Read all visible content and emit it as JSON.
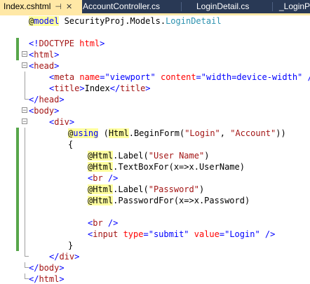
{
  "tabs": [
    {
      "label": "Index.cshtml",
      "active": true
    },
    {
      "label": "AccountController.cs",
      "active": false
    },
    {
      "label": "LoginDetail.cs",
      "active": false
    },
    {
      "label": "_LoginP",
      "active": false
    }
  ],
  "icons": {
    "pin": "pin-icon",
    "close": "close-icon",
    "collapse": "collapse-minus-icon"
  },
  "colors": {
    "tab_strip": "#293955",
    "active_tab": "#ffe8a6",
    "change_bar": "#57a64a",
    "razor_highlight": "#ffff9e"
  },
  "code": {
    "l1": {
      "at": "@",
      "kw": "model",
      "ns": " SecurityProj.Models.",
      "type": "LoginDetail"
    },
    "l3": {
      "open": "<!",
      "tag": "DOCTYPE",
      "attr": " html",
      "close": ">"
    },
    "l4": {
      "open": "<",
      "tag": "html",
      "close": ">"
    },
    "l5": {
      "open": "<",
      "tag": "head",
      "close": ">"
    },
    "l6": {
      "open": "<",
      "tag": "meta",
      "a1": " name",
      "eq1": "=",
      "v1": "\"viewport\"",
      "a2": " content",
      "eq2": "=",
      "v2": "\"width=device-width\"",
      "close": " />"
    },
    "l7": {
      "open": "<",
      "tag": "title",
      "mid": ">",
      "text": "Index",
      "open2": "</",
      "tag2": "title",
      "close": ">"
    },
    "l8": {
      "open": "</",
      "tag": "head",
      "close": ">"
    },
    "l9": {
      "open": "<",
      "tag": "body",
      "close": ">"
    },
    "l10": {
      "open": "<",
      "tag": "div",
      "close": ">"
    },
    "l11": {
      "at": "@",
      "kw": "using",
      "p1": " (",
      "html": "Html",
      "m": ".BeginForm(",
      "s1": "\"Login\"",
      "c": ", ",
      "s2": "\"Account\"",
      "p2": "))"
    },
    "l12": {
      "text": "{"
    },
    "l13": {
      "at": "@",
      "html": "Html",
      "m": ".Label(",
      "s": "\"User Name\"",
      "p": ")"
    },
    "l14": {
      "at": "@",
      "html": "Html",
      "m": ".TextBoxFor(x=>x.UserName)"
    },
    "l15": {
      "open": "<",
      "tag": "br",
      "close": " />"
    },
    "l16": {
      "at": "@",
      "html": "Html",
      "m": ".Label(",
      "s": "\"Password\"",
      "p": ")"
    },
    "l17": {
      "at": "@",
      "html": "Html",
      "m": ".PasswordFor(x=>x.Password)"
    },
    "l19": {
      "open": "<",
      "tag": "br",
      "close": " />"
    },
    "l20": {
      "open": "<",
      "tag": "input",
      "a1": " type",
      "eq1": "=",
      "v1": "\"submit\"",
      "a2": " value",
      "eq2": "=",
      "v2": "\"Login\"",
      "close": " />"
    },
    "l21": {
      "text": "}"
    },
    "l22": {
      "open": "</",
      "tag": "div",
      "close": ">"
    },
    "l23": {
      "open": "</",
      "tag": "body",
      "close": ">"
    },
    "l24": {
      "open": "</",
      "tag": "html",
      "close": ">"
    }
  }
}
